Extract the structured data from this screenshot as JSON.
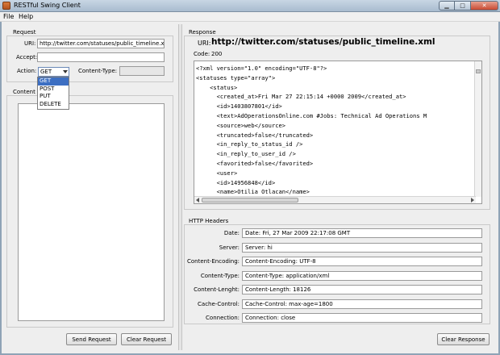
{
  "window": {
    "title": "RESTful Swing Client"
  },
  "menu": [
    "File",
    "Help"
  ],
  "request": {
    "section_label": "Request",
    "uri_label": "URI:",
    "uri_value": "http://twitter.com/statuses/public_timeline.xml",
    "accept_label": "Accept:",
    "accept_value": "",
    "action_label": "Action:",
    "action_selected": "GET",
    "action_options": [
      "GET",
      "POST",
      "PUT",
      "DELETE"
    ],
    "content_type_label": "Content-Type:",
    "content_type_value": "",
    "content_label": "Content T",
    "send_button": "Send Request",
    "clear_button": "Clear Request"
  },
  "response": {
    "section_label": "Response",
    "uri_label": "URI:",
    "uri_value": "http://twitter.com/statuses/public_timeline.xml",
    "code_label": "Code:",
    "code_value": "200",
    "body_lines": [
      "<?xml version=\"1.0\" encoding=\"UTF-8\"?>",
      "<statuses type=\"array\">",
      "    <status>",
      "      <created_at>Fri Mar 27 22:15:14 +0000 2009</created_at>",
      "      <id>1403807801</id>",
      "      <text>AdOperationsOnline.com #Jobs: Technical Ad Operations M",
      "      <source>web</source>",
      "      <truncated>false</truncated>",
      "      <in_reply_to_status_id />",
      "      <in_reply_to_user_id />",
      "      <favorited>false</favorited>",
      "      <user>",
      "      <id>14956848</id>",
      "      <name>Otilia Otlacan</name>"
    ],
    "clear_button": "Clear Response"
  },
  "headers": {
    "section_label": "HTTP Headers",
    "rows": [
      {
        "label": "Date:",
        "value": "Date: Fri, 27 Mar 2009 22:17:08 GMT"
      },
      {
        "label": "Server:",
        "value": "Server: hi"
      },
      {
        "label": "Content-Encoding:",
        "value": "Content-Encoding: UTF-8"
      },
      {
        "label": "Content-Type:",
        "value": "Content-Type: application/xml"
      },
      {
        "label": "Content-Lenght:",
        "value": "Content-Length: 18126"
      },
      {
        "label": "Cache-Control:",
        "value": "Cache-Control: max-age=1800"
      },
      {
        "label": "Connection:",
        "value": "Connection: close"
      }
    ]
  },
  "icons": {
    "app": "app-icon",
    "minimize": "minimize-icon",
    "maximize": "maximize-icon",
    "close": "close-icon"
  },
  "colors": {
    "selection": "#3d6fc2",
    "titlebar": "#b7c8da"
  }
}
